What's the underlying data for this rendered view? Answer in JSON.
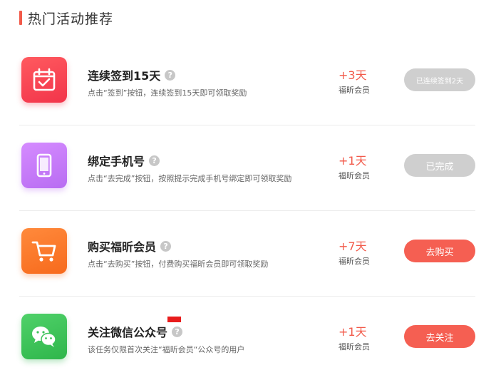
{
  "section": {
    "title": "热门活动推荐"
  },
  "colors": {
    "accent": "#f25a4a",
    "button_done": "#cfcfcf",
    "button_action": "#f55f52"
  },
  "tasks": [
    {
      "title": "连续签到15天",
      "help": "?",
      "desc": "点击“签到”按钮，连续签到15天即可领取奖励",
      "reward_amount": "+3天",
      "reward_label": "福昕会员",
      "button": "已连续签到2天",
      "icon": "calendar-check-icon"
    },
    {
      "title": "绑定手机号",
      "help": "?",
      "desc": "点击“去完成”按钮，按照提示完成手机号绑定即可领取奖励",
      "reward_amount": "+1天",
      "reward_label": "福昕会员",
      "button": "已完成",
      "icon": "phone-icon"
    },
    {
      "title": "购买福昕会员",
      "help": "?",
      "desc": "点击“去购买”按钮，付费购买福昕会员即可领取奖励",
      "reward_amount": "+7天",
      "reward_label": "福昕会员",
      "button": "去购买",
      "icon": "shopping-cart-icon"
    },
    {
      "title": "关注微信公众号",
      "help": "?",
      "desc": "该任务仅限首次关注“福昕会员“公众号的用户",
      "reward_amount": "+1天",
      "reward_label": "福昕会员",
      "button": "去关注",
      "icon": "wechat-icon"
    }
  ]
}
